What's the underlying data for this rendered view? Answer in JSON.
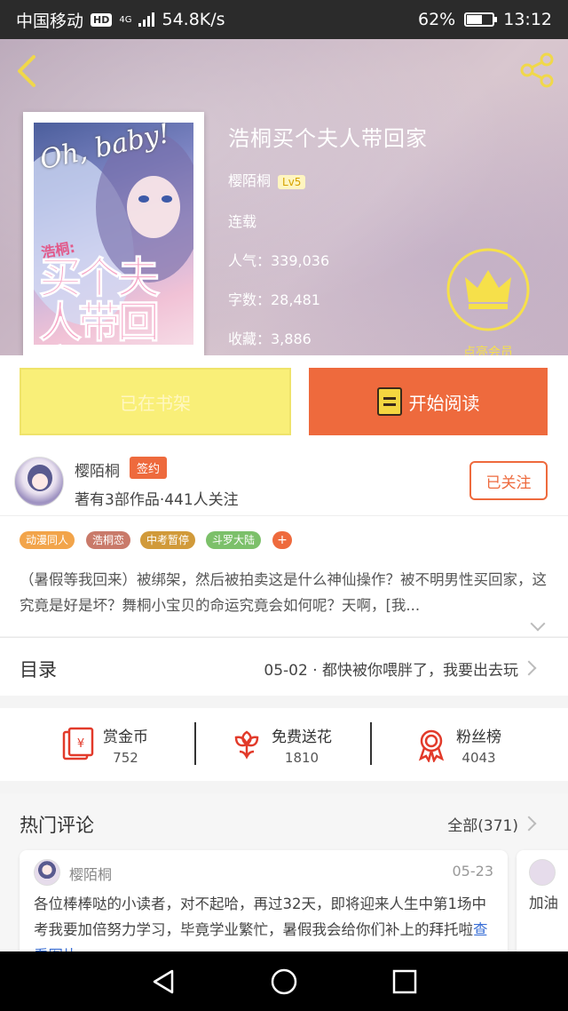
{
  "status_bar": {
    "carrier": "中国移动",
    "hd_badge": "HD",
    "network": "4G",
    "speed": "54.8K/s",
    "battery_pct": "62%",
    "battery_level": 0.62,
    "time": "13:12"
  },
  "book": {
    "cover_title_en": "Oh, baby!",
    "cover_title_cn": "买个夫人带回家",
    "cover_tag": "浩桐:",
    "title": "浩桐买个夫人带回家",
    "author": "樱陌桐",
    "level": "Lv5",
    "status": "连载",
    "popularity": "人气：339,036",
    "word_count": "字数：28,481",
    "favorites": "收藏：3,886"
  },
  "vip": {
    "label": "点亮会员"
  },
  "actions": {
    "shelf_label": "已在书架",
    "read_label": "开始阅读"
  },
  "author": {
    "name": "樱陌桐",
    "badge": "签约",
    "meta": "著有3部作品·441人关注",
    "follow_label": "已关注"
  },
  "tags": [
    {
      "label": "动漫同人",
      "color": "#f2a44a"
    },
    {
      "label": "浩桐恋",
      "color": "#c97a6a"
    },
    {
      "label": "中考暂停",
      "color": "#d19a3a"
    },
    {
      "label": "斗罗大陆",
      "color": "#7cc06a"
    }
  ],
  "tag_more": "+",
  "description": "（暑假等我回来）被绑架，然后被拍卖这是什么神仙操作？被不明男性买回家，这究竟是好是坏？舞桐小宝贝的命运究竟会如何呢？天啊，[我...",
  "catalog": {
    "label": "目录",
    "latest": "05-02 · 都快被你喂胖了，我要出去玩"
  },
  "stats": [
    {
      "label": "赏金币",
      "value": "752",
      "icon": "red-envelope-icon"
    },
    {
      "label": "免费送花",
      "value": "1810",
      "icon": "flower-icon"
    },
    {
      "label": "粉丝榜",
      "value": "4043",
      "icon": "medal-icon"
    }
  ],
  "comments": {
    "label": "热门评论",
    "all_label": "全部(371)",
    "items": [
      {
        "user": "樱陌桐",
        "date": "05-23",
        "text": "各位棒棒哒的小读者，对不起哈，再过32天，即将迎来人生中第1场中考我要加倍努力学习，毕竟学业繁忙，暑假我会给你们补上的拜托啦",
        "link": "查看图片"
      },
      {
        "text": "加油"
      }
    ]
  },
  "colors": {
    "accent": "#ee6a3d",
    "shelf_button": "#f9ef78",
    "vip_yellow": "#f6e04a"
  }
}
